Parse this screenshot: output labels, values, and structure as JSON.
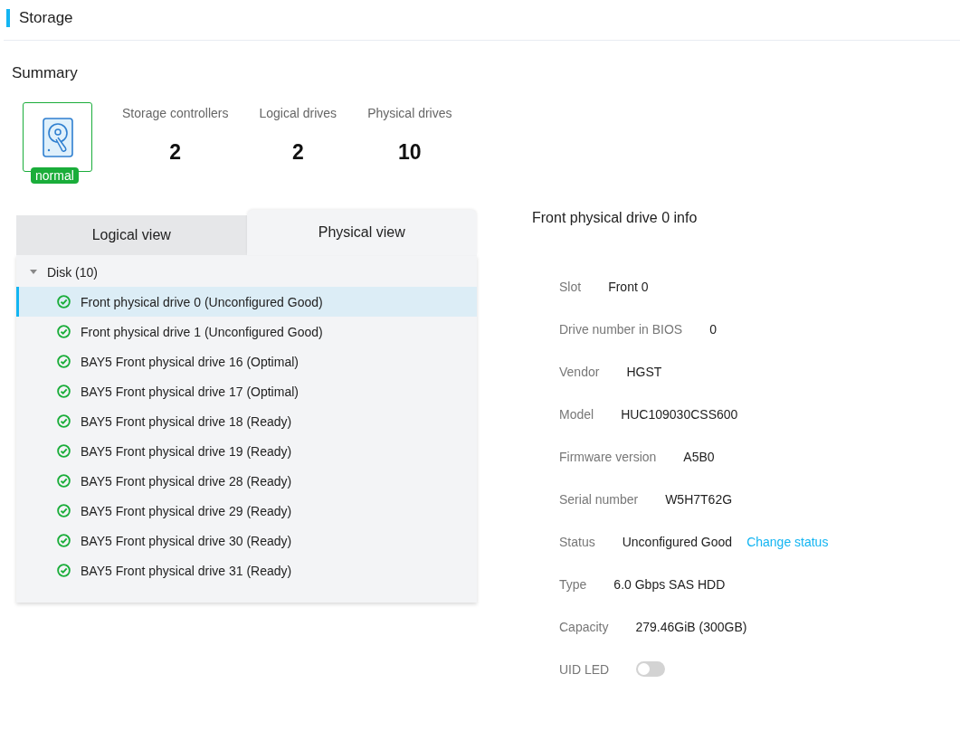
{
  "header": {
    "title": "Storage"
  },
  "summary": {
    "title": "Summary",
    "health": {
      "label": "normal",
      "color": "#1aad3a"
    },
    "stats": [
      {
        "label": "Storage controllers",
        "value": "2"
      },
      {
        "label": "Logical drives",
        "value": "2"
      },
      {
        "label": "Physical drives",
        "value": "10"
      }
    ]
  },
  "tabs": [
    {
      "label": "Logical view",
      "selected": false
    },
    {
      "label": "Physical view",
      "selected": true
    }
  ],
  "tree": [
    {
      "label": "Disk (10)",
      "expanded": true,
      "children": [
        {
          "label": "Front physical drive 0 (Unconfigured Good)",
          "selected": true
        },
        {
          "label": "Front physical drive 1 (Unconfigured Good)",
          "selected": false
        },
        {
          "label": "BAY5 Front physical drive 16 (Optimal)",
          "selected": false
        },
        {
          "label": "BAY5 Front physical drive 17 (Optimal)",
          "selected": false
        },
        {
          "label": "BAY5 Front physical drive 18 (Ready)",
          "selected": false
        },
        {
          "label": "BAY5 Front physical drive 19 (Ready)",
          "selected": false
        },
        {
          "label": "BAY5 Front physical drive 28 (Ready)",
          "selected": false
        },
        {
          "label": "BAY5 Front physical drive 29 (Ready)",
          "selected": false
        },
        {
          "label": "BAY5 Front physical drive 30 (Ready)",
          "selected": false
        },
        {
          "label": "BAY5 Front physical drive 31 (Ready)",
          "selected": false
        }
      ]
    }
  ],
  "info": {
    "title": "Front physical drive 0 info",
    "fields": [
      {
        "kind": "text",
        "label": "Slot",
        "value": "Front 0"
      },
      {
        "kind": "text",
        "label": "Drive number in BIOS",
        "value": "0"
      },
      {
        "kind": "text",
        "label": "Vendor",
        "value": "HGST"
      },
      {
        "kind": "text",
        "label": "Model",
        "value": "HUC109030CSS600"
      },
      {
        "kind": "text",
        "label": "Firmware version",
        "value": "A5B0"
      },
      {
        "kind": "text",
        "label": "Serial number",
        "value": "W5H7T62G"
      },
      {
        "kind": "link",
        "label": "Status",
        "value": "Unconfigured Good",
        "link": "Change status"
      },
      {
        "kind": "text",
        "label": "Type",
        "value": "6.0 Gbps SAS HDD"
      },
      {
        "kind": "text",
        "label": "Capacity",
        "value": "279.46GiB (300GB)"
      },
      {
        "kind": "toggle",
        "label": "UID LED",
        "on": false
      }
    ]
  }
}
